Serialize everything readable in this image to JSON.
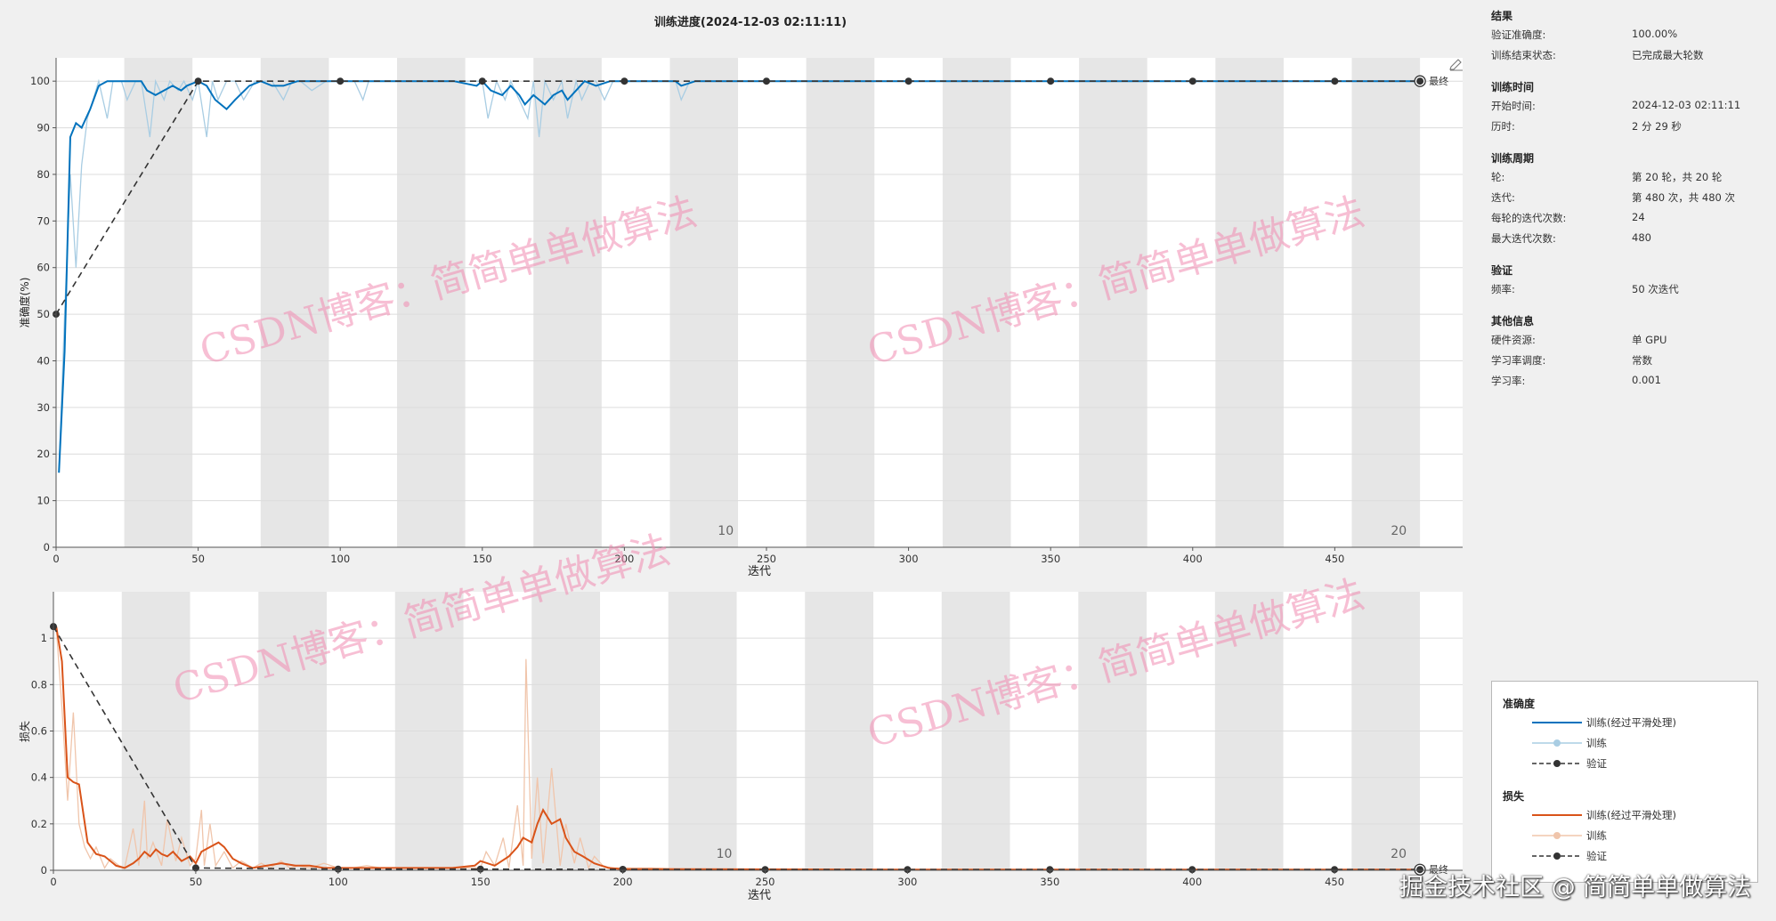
{
  "title": "训练进度(2024-12-03 02:11:11)",
  "colors": {
    "acc_smooth": "#0072bd",
    "acc_raw": "#a9cde3",
    "loss_smooth": "#d95319",
    "loss_raw": "#f0c5ab",
    "validation": "#333333",
    "epoch_band": "#e6e6e6",
    "grid": "#dcdcdc"
  },
  "chart_data": [
    {
      "type": "line",
      "name": "accuracy",
      "ylabel": "准确度(%)",
      "xlabel": "迭代",
      "xlim": [
        0,
        495
      ],
      "ylim": [
        0,
        105
      ],
      "xticks": [
        0,
        50,
        100,
        150,
        200,
        250,
        300,
        350,
        400,
        450
      ],
      "yticks": [
        0,
        10,
        20,
        30,
        40,
        50,
        60,
        70,
        80,
        90,
        100
      ],
      "epoch_markers": [
        {
          "x": 220,
          "label": "10"
        },
        {
          "x": 460,
          "label": "20"
        }
      ],
      "final_label": "最终",
      "grid": true,
      "series": [
        {
          "name": "训练(经过平滑处理)",
          "x": [
            1,
            3,
            5,
            7,
            9,
            12,
            15,
            18,
            22,
            25,
            30,
            32,
            35,
            38,
            41,
            44,
            46,
            50,
            53,
            56,
            58,
            60,
            63,
            68,
            72,
            76,
            80,
            85,
            90,
            95,
            100,
            110,
            120,
            140,
            148,
            150,
            153,
            157,
            160,
            163,
            165,
            168,
            170,
            172,
            175,
            178,
            180,
            183,
            186,
            190,
            195,
            200,
            210,
            218,
            220,
            225,
            230,
            240,
            260,
            300,
            350,
            400,
            450,
            480
          ],
          "y": [
            16,
            42,
            88,
            91,
            90,
            94,
            99,
            100,
            100,
            100,
            100,
            98,
            97,
            98,
            99,
            98,
            99,
            100,
            99,
            96,
            95,
            94,
            96,
            99,
            100,
            99,
            99,
            100,
            100,
            100,
            100,
            100,
            100,
            100,
            99,
            100,
            98,
            97,
            99,
            97,
            95,
            97,
            96,
            95,
            97,
            98,
            96,
            98,
            100,
            99,
            100,
            100,
            100,
            100,
            99,
            100,
            100,
            100,
            100,
            100,
            100,
            100,
            100,
            100
          ]
        },
        {
          "name": "训练",
          "x": [
            1,
            3,
            5,
            7,
            9,
            11,
            13,
            15,
            18,
            20,
            23,
            25,
            28,
            30,
            33,
            35,
            38,
            40,
            43,
            45,
            48,
            50,
            52,
            53,
            55,
            57,
            60,
            63,
            66,
            70,
            73,
            76,
            80,
            83,
            86,
            90,
            95,
            100,
            105,
            108,
            110,
            115,
            120,
            130,
            140,
            150,
            152,
            155,
            158,
            160,
            163,
            166,
            168,
            170,
            172,
            175,
            178,
            180,
            183,
            185,
            188,
            190,
            193,
            196,
            200,
            205,
            210,
            218,
            220,
            223,
            226,
            230,
            240,
            260,
            300,
            350,
            400,
            450,
            480
          ],
          "y": [
            16,
            50,
            80,
            60,
            82,
            92,
            96,
            100,
            92,
            100,
            100,
            96,
            100,
            100,
            88,
            100,
            96,
            100,
            98,
            100,
            96,
            100,
            92,
            88,
            100,
            96,
            100,
            100,
            96,
            100,
            100,
            100,
            96,
            100,
            100,
            98,
            100,
            100,
            100,
            96,
            100,
            100,
            100,
            100,
            100,
            100,
            92,
            100,
            96,
            100,
            96,
            92,
            100,
            88,
            100,
            96,
            100,
            92,
            100,
            96,
            100,
            100,
            96,
            100,
            100,
            100,
            100,
            100,
            96,
            100,
            100,
            100,
            100,
            100,
            100,
            100,
            100,
            100,
            100
          ]
        },
        {
          "name": "验证",
          "x": [
            0,
            50,
            100,
            150,
            200,
            250,
            300,
            350,
            400,
            450,
            480
          ],
          "y": [
            50,
            100,
            100,
            100,
            100,
            100,
            100,
            100,
            100,
            100,
            100
          ]
        }
      ]
    },
    {
      "type": "line",
      "name": "loss",
      "ylabel": "损失",
      "xlabel": "迭代",
      "xlim": [
        0,
        495
      ],
      "ylim": [
        0,
        1.2
      ],
      "xticks": [
        0,
        50,
        100,
        150,
        200,
        250,
        300,
        350,
        400,
        450
      ],
      "yticks": [
        0,
        0.2,
        0.4,
        0.6,
        0.8,
        1
      ],
      "epoch_markers": [
        {
          "x": 220,
          "label": "10"
        },
        {
          "x": 460,
          "label": "20"
        }
      ],
      "final_label": "最终",
      "grid": true,
      "series": [
        {
          "name": "训练(经过平滑处理)",
          "x": [
            1,
            3,
            5,
            7,
            9,
            12,
            15,
            18,
            22,
            25,
            28,
            30,
            32,
            34,
            36,
            38,
            40,
            42,
            45,
            48,
            50,
            52,
            55,
            58,
            60,
            63,
            66,
            70,
            75,
            80,
            85,
            90,
            95,
            100,
            120,
            140,
            148,
            150,
            155,
            160,
            163,
            165,
            168,
            170,
            172,
            175,
            178,
            180,
            183,
            186,
            190,
            195,
            200,
            220,
            260,
            300,
            350,
            400,
            450,
            480
          ],
          "y": [
            1.05,
            0.9,
            0.4,
            0.38,
            0.37,
            0.12,
            0.07,
            0.06,
            0.02,
            0.01,
            0.03,
            0.05,
            0.08,
            0.06,
            0.09,
            0.07,
            0.06,
            0.08,
            0.04,
            0.06,
            0.03,
            0.08,
            0.1,
            0.12,
            0.1,
            0.05,
            0.03,
            0.01,
            0.02,
            0.03,
            0.02,
            0.02,
            0.01,
            0.01,
            0.01,
            0.01,
            0.02,
            0.04,
            0.02,
            0.06,
            0.1,
            0.14,
            0.12,
            0.2,
            0.26,
            0.2,
            0.22,
            0.14,
            0.08,
            0.06,
            0.03,
            0.01,
            0.005,
            0.005,
            0.004,
            0.003,
            0.003,
            0.003,
            0.003,
            0.003
          ]
        },
        {
          "name": "训练",
          "x": [
            1,
            3,
            5,
            7,
            9,
            11,
            13,
            15,
            18,
            20,
            23,
            25,
            28,
            30,
            32,
            33,
            35,
            38,
            40,
            43,
            45,
            48,
            50,
            52,
            53,
            55,
            57,
            60,
            63,
            66,
            70,
            73,
            76,
            80,
            83,
            86,
            90,
            95,
            100,
            105,
            110,
            115,
            120,
            130,
            140,
            150,
            152,
            155,
            158,
            160,
            163,
            165,
            166,
            168,
            170,
            172,
            175,
            178,
            180,
            183,
            185,
            188,
            190,
            193,
            196,
            200,
            210,
            220,
            240,
            260,
            300,
            350,
            400,
            450,
            480
          ],
          "y": [
            1.05,
            0.7,
            0.3,
            0.68,
            0.2,
            0.1,
            0.05,
            0.1,
            0.01,
            0.05,
            0.02,
            0.01,
            0.18,
            0.02,
            0.3,
            0.05,
            0.12,
            0.02,
            0.22,
            0.04,
            0.14,
            0.02,
            0.05,
            0.26,
            0.02,
            0.2,
            0.02,
            0.08,
            0.01,
            0.04,
            0.01,
            0.03,
            0.01,
            0.04,
            0.01,
            0.02,
            0.01,
            0.03,
            0.01,
            0.01,
            0.02,
            0.01,
            0.01,
            0.01,
            0.01,
            0.01,
            0.08,
            0.02,
            0.14,
            0.01,
            0.28,
            0.02,
            0.91,
            0.05,
            0.4,
            0.03,
            0.44,
            0.02,
            0.2,
            0.03,
            0.14,
            0.01,
            0.06,
            0.02,
            0.01,
            0.01,
            0.01,
            0.005,
            0.005,
            0.004,
            0.003,
            0.003,
            0.003,
            0.003,
            0.003
          ]
        },
        {
          "name": "验证",
          "x": [
            0,
            50,
            100,
            150,
            200,
            250,
            300,
            350,
            400,
            450,
            480
          ],
          "y": [
            1.05,
            0.01,
            0.005,
            0.005,
            0.004,
            0.003,
            0.003,
            0.003,
            0.003,
            0.003,
            0.003
          ]
        }
      ]
    }
  ],
  "panel": {
    "sections": [
      {
        "title": "结果",
        "rows": [
          {
            "label": "验证准确度:",
            "value": "100.00%"
          },
          {
            "label": "训练结束状态:",
            "value": "已完成最大轮数"
          }
        ]
      },
      {
        "title": "训练时间",
        "rows": [
          {
            "label": "开始时间:",
            "value": "2024-12-03 02:11:11"
          },
          {
            "label": "历时:",
            "value": "2 分 29 秒"
          }
        ]
      },
      {
        "title": "训练周期",
        "rows": [
          {
            "label": "轮:",
            "value": "第 20 轮，共 20 轮"
          },
          {
            "label": "迭代:",
            "value": "第 480 次，共 480 次"
          },
          {
            "label": "每轮的迭代次数:",
            "value": "24"
          },
          {
            "label": "最大迭代次数:",
            "value": "480"
          }
        ]
      },
      {
        "title": "验证",
        "rows": [
          {
            "label": "频率:",
            "value": "50 次迭代"
          }
        ]
      },
      {
        "title": "其他信息",
        "rows": [
          {
            "label": "硬件资源:",
            "value": "单 GPU"
          },
          {
            "label": "学习率调度:",
            "value": "常数"
          },
          {
            "label": "学习率:",
            "value": "0.001"
          }
        ]
      }
    ]
  },
  "legend": {
    "accuracy_title": "准确度",
    "loss_title": "损失",
    "smooth": "训练(经过平滑处理)",
    "raw": "训练",
    "validation": "验证"
  },
  "watermarks": {
    "diagonal": "CSDN博客：简简单单做算法",
    "bottom": "掘金技术社区 @ 简简单单做算法"
  }
}
